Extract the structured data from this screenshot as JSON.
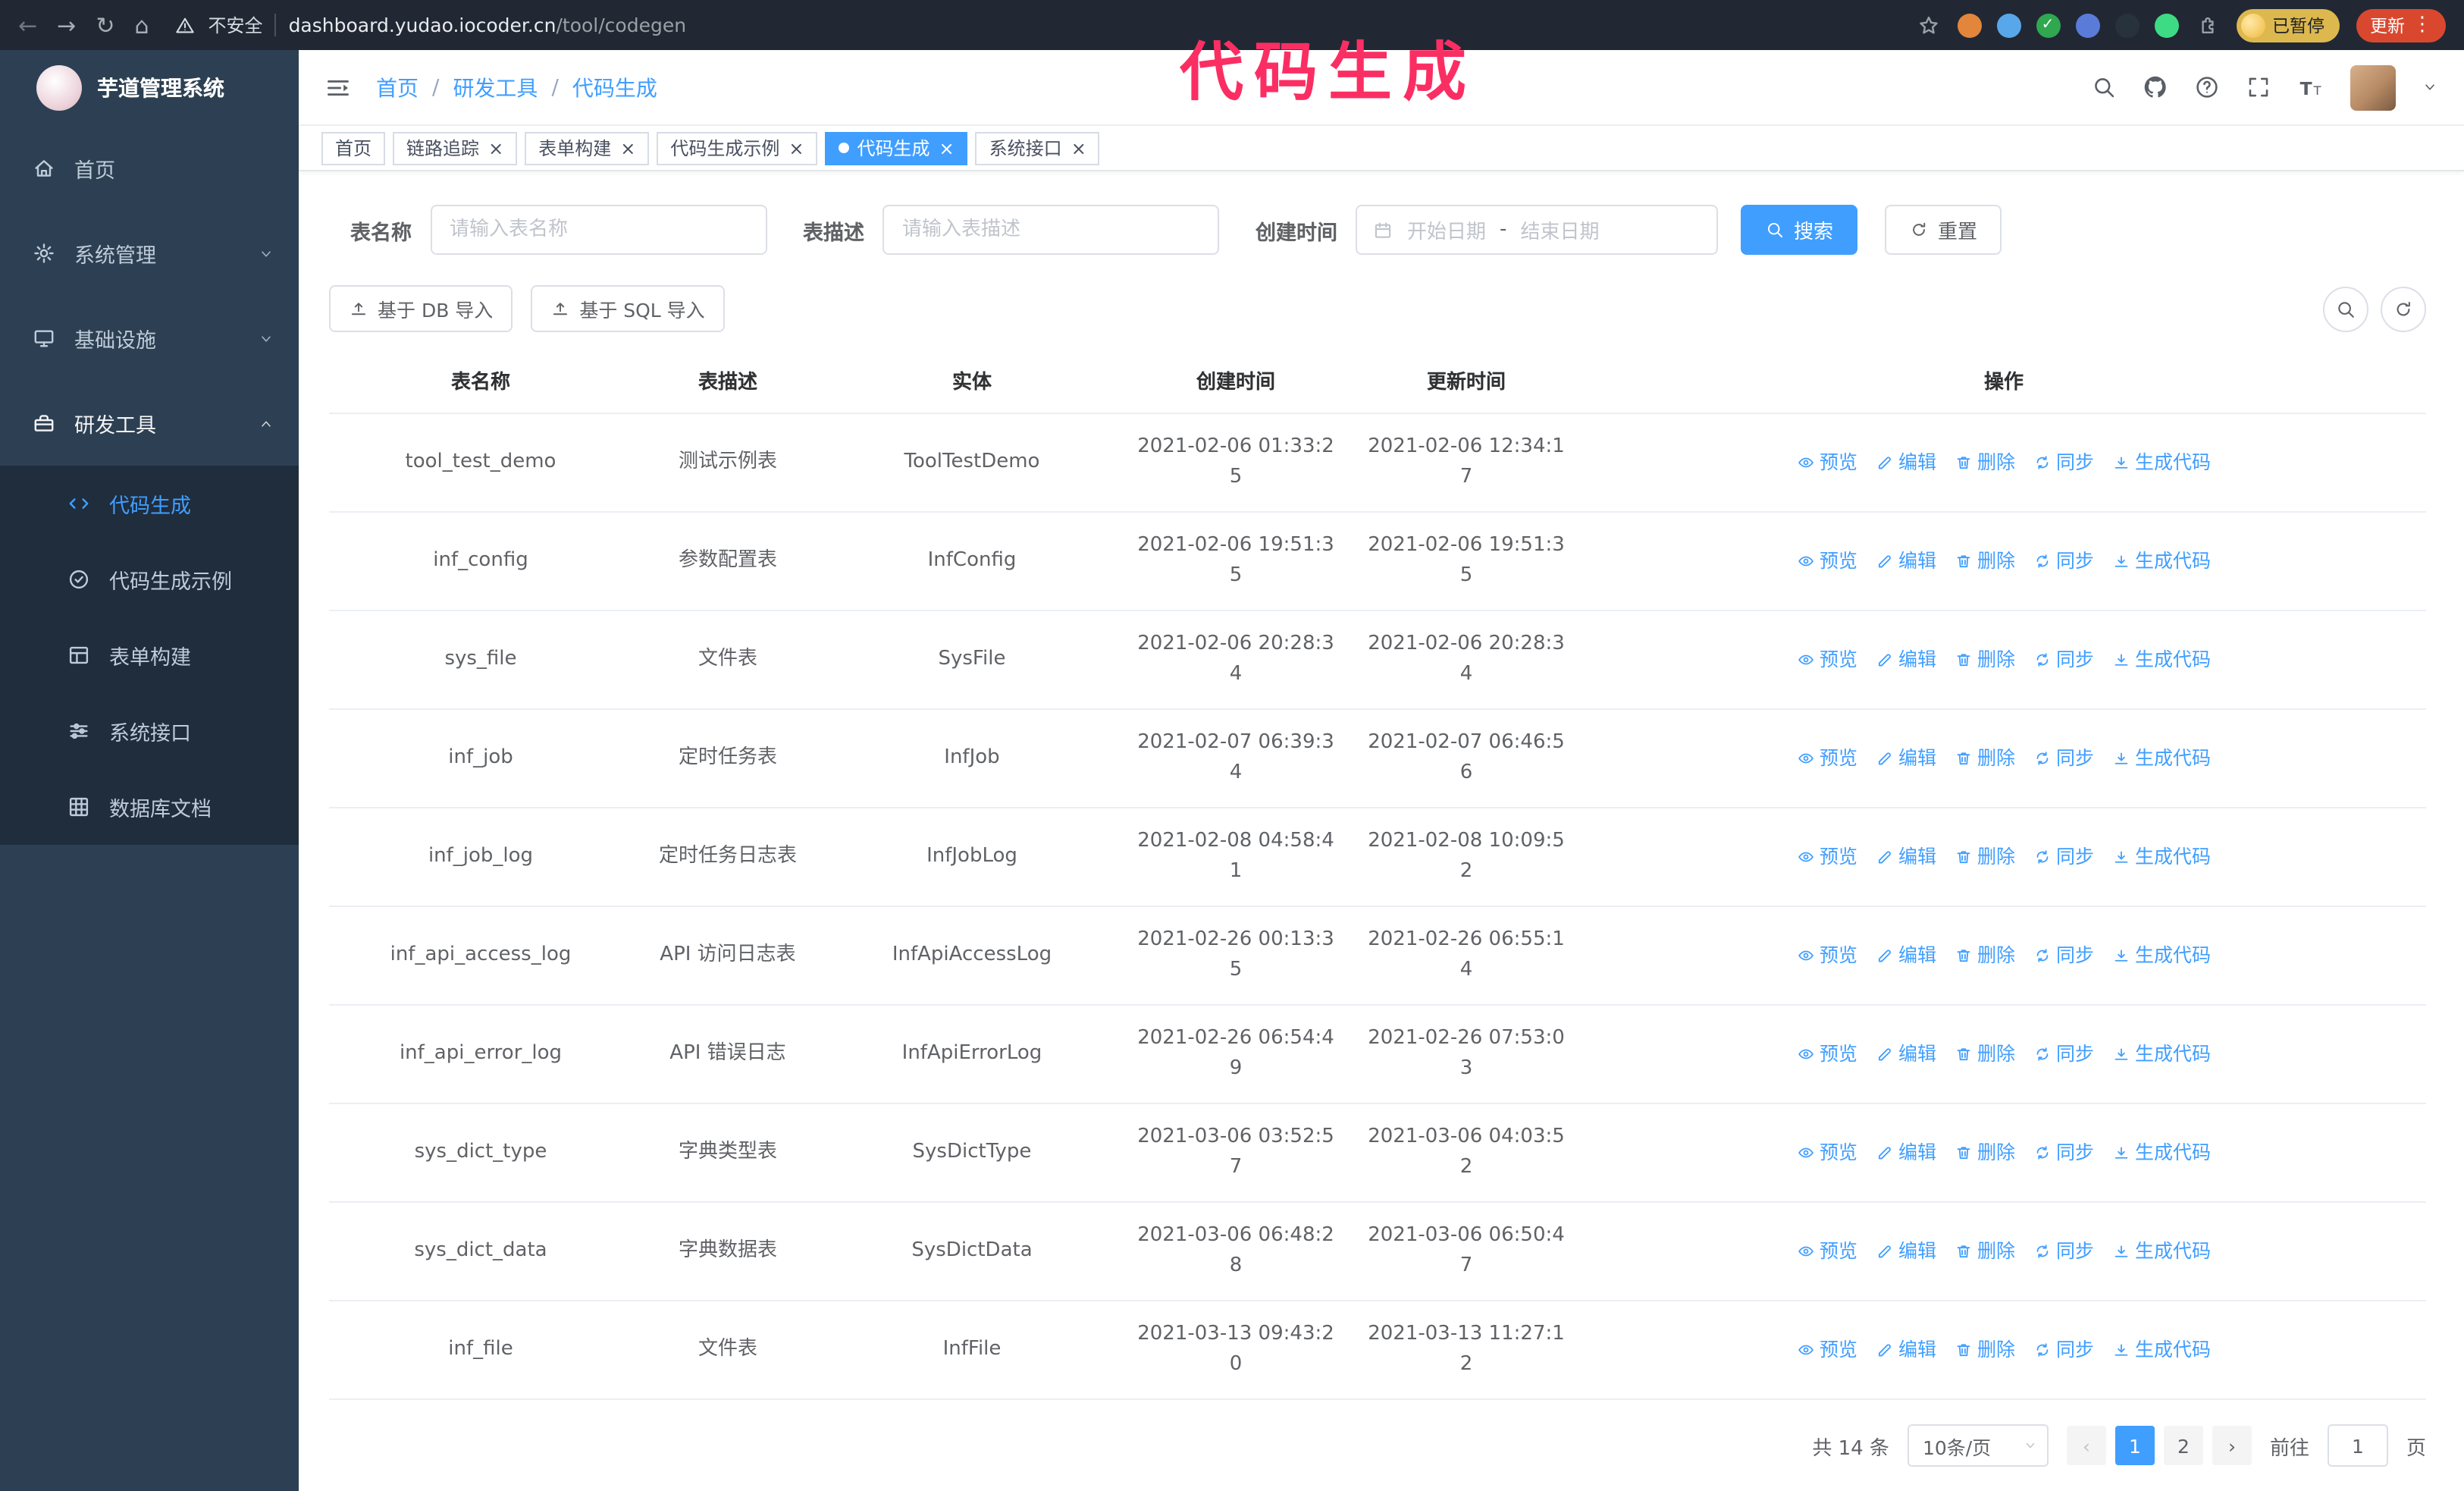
{
  "annotation": {
    "text": "代码生成",
    "color": "#fb2e63"
  },
  "browser": {
    "security_text": "不安全",
    "url_host": "dashboard.yudao.iocoder.cn",
    "url_path": "/tool/codegen",
    "profile_badge": "已暂停",
    "update_label": "更新",
    "extension_colors": [
      "#e2863b",
      "#58a7ea",
      "#2fa84f",
      "#5a7bd8",
      "#27323c",
      "#3ddc84"
    ]
  },
  "sidebar": {
    "logo_title": "芋道管理系统",
    "items": [
      {
        "key": "home",
        "label": "首页",
        "icon": "home-icon"
      },
      {
        "key": "system",
        "label": "系统管理",
        "icon": "gear-icon",
        "chevron": "down"
      },
      {
        "key": "infra",
        "label": "基础设施",
        "icon": "monitor-icon",
        "chevron": "down"
      },
      {
        "key": "devtools",
        "label": "研发工具",
        "icon": "tools-icon",
        "chevron": "up",
        "expanded": true
      }
    ],
    "subitems": [
      {
        "key": "codegen",
        "label": "代码生成",
        "icon": "code-icon",
        "active": true
      },
      {
        "key": "codegen-example",
        "label": "代码生成示例",
        "icon": "badge-icon"
      },
      {
        "key": "form-build",
        "label": "表单构建",
        "icon": "form-icon"
      },
      {
        "key": "api",
        "label": "系统接口",
        "icon": "sliders-icon"
      },
      {
        "key": "db-doc",
        "label": "数据库文档",
        "icon": "grid-icon"
      }
    ]
  },
  "header": {
    "breadcrumb": [
      "首页",
      "研发工具",
      "代码生成"
    ]
  },
  "tabs": [
    {
      "label": "首页",
      "closable": false,
      "active": false
    },
    {
      "label": "链路追踪",
      "closable": true,
      "active": false
    },
    {
      "label": "表单构建",
      "closable": true,
      "active": false
    },
    {
      "label": "代码生成示例",
      "closable": true,
      "active": false
    },
    {
      "label": "代码生成",
      "closable": true,
      "active": true
    },
    {
      "label": "系统接口",
      "closable": true,
      "active": false
    }
  ],
  "filters": {
    "name_label": "表名称",
    "name_placeholder": "请输入表名称",
    "desc_label": "表描述",
    "desc_placeholder": "请输入表描述",
    "time_label": "创建时间",
    "start_placeholder": "开始日期",
    "range_separator": "-",
    "end_placeholder": "结束日期",
    "search_label": "搜索",
    "reset_label": "重置"
  },
  "toolbar": {
    "import_db_label": "基于 DB 导入",
    "import_sql_label": "基于 SQL 导入"
  },
  "table": {
    "columns": [
      "表名称",
      "表描述",
      "实体",
      "创建时间",
      "更新时间",
      "操作"
    ],
    "actions": [
      {
        "key": "preview",
        "label": "预览",
        "icon": "eye-icon"
      },
      {
        "key": "edit",
        "label": "编辑",
        "icon": "edit-icon"
      },
      {
        "key": "delete",
        "label": "删除",
        "icon": "delete-icon"
      },
      {
        "key": "sync",
        "label": "同步",
        "icon": "sync-icon"
      },
      {
        "key": "generate",
        "label": "生成代码",
        "icon": "download-icon"
      }
    ],
    "rows": [
      {
        "name": "tool_test_demo",
        "desc": "测试示例表",
        "entity": "ToolTestDemo",
        "created": "2021-02-06 01:33:25",
        "updated": "2021-02-06 12:34:17"
      },
      {
        "name": "inf_config",
        "desc": "参数配置表",
        "entity": "InfConfig",
        "created": "2021-02-06 19:51:35",
        "updated": "2021-02-06 19:51:35"
      },
      {
        "name": "sys_file",
        "desc": "文件表",
        "entity": "SysFile",
        "created": "2021-02-06 20:28:34",
        "updated": "2021-02-06 20:28:34"
      },
      {
        "name": "inf_job",
        "desc": "定时任务表",
        "entity": "InfJob",
        "created": "2021-02-07 06:39:34",
        "updated": "2021-02-07 06:46:56"
      },
      {
        "name": "inf_job_log",
        "desc": "定时任务日志表",
        "entity": "InfJobLog",
        "created": "2021-02-08 04:58:41",
        "updated": "2021-02-08 10:09:52"
      },
      {
        "name": "inf_api_access_log",
        "desc": "API 访问日志表",
        "entity": "InfApiAccessLog",
        "created": "2021-02-26 00:13:35",
        "updated": "2021-02-26 06:55:14"
      },
      {
        "name": "inf_api_error_log",
        "desc": "API 错误日志",
        "entity": "InfApiErrorLog",
        "created": "2021-02-26 06:54:49",
        "updated": "2021-02-26 07:53:03"
      },
      {
        "name": "sys_dict_type",
        "desc": "字典类型表",
        "entity": "SysDictType",
        "created": "2021-03-06 03:52:57",
        "updated": "2021-03-06 04:03:52"
      },
      {
        "name": "sys_dict_data",
        "desc": "字典数据表",
        "entity": "SysDictData",
        "created": "2021-03-06 06:48:28",
        "updated": "2021-03-06 06:50:47"
      },
      {
        "name": "inf_file",
        "desc": "文件表",
        "entity": "InfFile",
        "created": "2021-03-13 09:43:20",
        "updated": "2021-03-13 11:27:12"
      }
    ]
  },
  "pagination": {
    "total_text": "共 14 条",
    "page_size_text": "10条/页",
    "pages": [
      "1",
      "2"
    ],
    "active_page": "1",
    "goto_label": "前往",
    "goto_value": "1",
    "goto_suffix": "页"
  },
  "colors": {
    "accent": "#409eff",
    "sidebar_bg": "#2d4053",
    "submenu_bg": "#1f2d3d",
    "active_tab": "#409eff"
  }
}
